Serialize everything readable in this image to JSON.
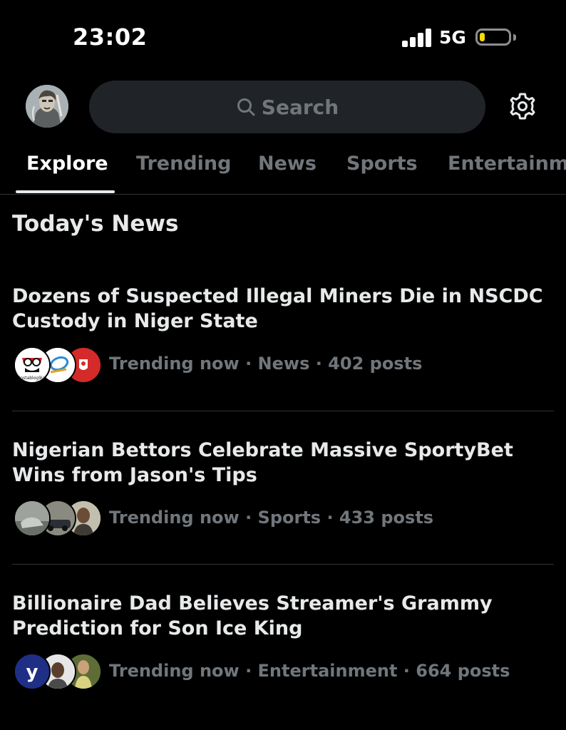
{
  "status_bar": {
    "time": "23:02",
    "network": "5G",
    "battery_level": 0.15,
    "icons": [
      "signal-icon",
      "battery-icon"
    ]
  },
  "top_bar": {
    "search_placeholder": "Search",
    "icons": [
      "search-icon",
      "gear-icon"
    ]
  },
  "tabs": [
    {
      "label": "Explore",
      "active": true
    },
    {
      "label": "Trending",
      "active": false
    },
    {
      "label": "News",
      "active": false
    },
    {
      "label": "Sports",
      "active": false
    },
    {
      "label": "Entertainm",
      "active": false
    }
  ],
  "section": {
    "title": "Today's News"
  },
  "news": [
    {
      "headline": "Dozens of Suspected Illegal Miners Die in NSCDC Custody in Niger State",
      "meta": "Trending now · News · 402 posts",
      "avatar_logo_text": "instablog9ja"
    },
    {
      "headline": "Nigerian Bettors Celebrate Massive SportyBet Wins from Jason's Tips",
      "meta": "Trending now · Sports · 433 posts"
    },
    {
      "headline": "Billionaire Dad Believes Streamer's Grammy Prediction for Son Ice King",
      "meta": "Trending now · Entertainment · 664 posts",
      "avatar_logo_text": "y"
    }
  ],
  "colors": {
    "background": "#000000",
    "text_primary": "#e7e9ea",
    "text_secondary": "#71767b",
    "search_bg": "#202327",
    "divider": "#2f3336",
    "battery": "#f5d90a"
  }
}
